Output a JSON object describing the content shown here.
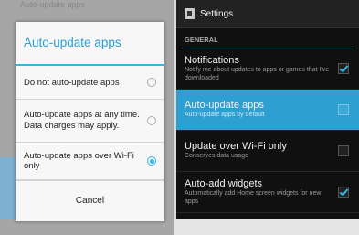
{
  "left": {
    "behind_text": "Auto-update apps",
    "dialog": {
      "title": "Auto-update apps",
      "options": [
        {
          "label": "Do not auto-update apps",
          "selected": false
        },
        {
          "label": "Auto-update apps at any time. Data charges may apply.",
          "selected": false
        },
        {
          "label": "Auto-update apps over Wi-Fi only",
          "selected": true
        }
      ],
      "cancel_label": "Cancel"
    }
  },
  "right": {
    "action_bar": {
      "title": "Settings",
      "icon": "settings-app-icon"
    },
    "section_header": "GENERAL",
    "prefs": [
      {
        "title": "Notifications",
        "summary": "Notify me about updates to apps or games that I've downloaded",
        "checked": true,
        "highlighted": false
      },
      {
        "title": "Auto-update apps",
        "summary": "Auto-update apps by default",
        "checked": false,
        "highlighted": true
      },
      {
        "title": "Update over Wi-Fi only",
        "summary": "Conserves data usage",
        "checked": false,
        "highlighted": false
      },
      {
        "title": "Auto-add widgets",
        "summary": "Automatically add Home screen widgets for new apps",
        "checked": true,
        "highlighted": false
      }
    ]
  },
  "colors": {
    "accent": "#34b5e5",
    "highlight": "#2e9fd1"
  }
}
